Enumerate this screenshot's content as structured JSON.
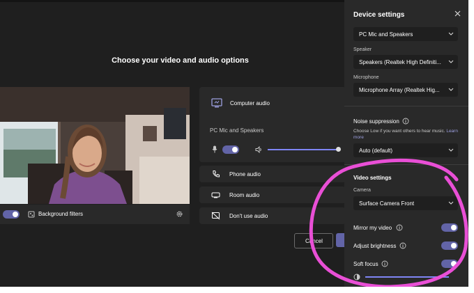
{
  "main": {
    "title": "Choose your video and audio options",
    "background_filters_label": "Background filters",
    "computer_audio_label": "Computer audio",
    "device_label": "PC Mic and Speakers",
    "phone_audio_label": "Phone audio",
    "room_audio_label": "Room audio",
    "dont_use_audio_label": "Don't use audio",
    "cancel_label": "Cancel"
  },
  "settings": {
    "title": "Device settings",
    "audio_device_value": "PC Mic and Speakers",
    "speaker_label": "Speaker",
    "speaker_value": "Speakers (Realtek High Definiti...",
    "microphone_label": "Microphone",
    "microphone_value": "Microphone Array (Realtek Hig...",
    "noise_suppression_label": "Noise suppression",
    "noise_help_text": "Choose Low if you want others to hear music.",
    "learn_more_label": "Learn more",
    "noise_value": "Auto (default)",
    "video_settings_label": "Video settings",
    "camera_label": "Camera",
    "camera_value": "Surface Camera Front",
    "mirror_label": "Mirror my video",
    "brightness_label": "Adjust brightness",
    "soft_focus_label": "Soft focus"
  },
  "colors": {
    "accent": "#6264a7",
    "annotation": "#e94fd6",
    "panel": "#292929",
    "background": "#1f1f1f"
  }
}
